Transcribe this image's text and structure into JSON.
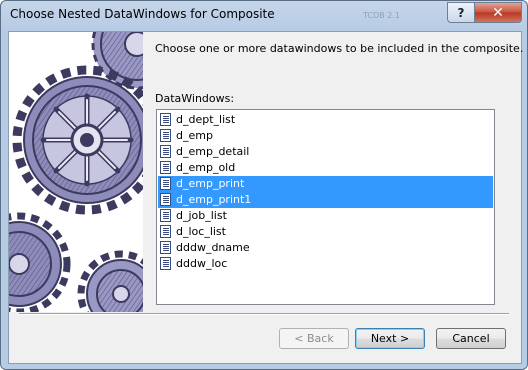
{
  "window": {
    "title": "Choose Nested DataWindows for Composite",
    "title_ghost_text": "TCDB 2.1",
    "help_label": "?",
    "close_label": "✕"
  },
  "intro_text": "Choose one or more datawindows to be included in the composite.",
  "list_label": "DataWindows:",
  "datawindows": [
    {
      "name": "d_dept_list",
      "selected": false
    },
    {
      "name": "d_emp",
      "selected": false
    },
    {
      "name": "d_emp_detail",
      "selected": false
    },
    {
      "name": "d_emp_old",
      "selected": false
    },
    {
      "name": "d_emp_print",
      "selected": true
    },
    {
      "name": "d_emp_print1",
      "selected": true
    },
    {
      "name": "d_job_list",
      "selected": false
    },
    {
      "name": "d_loc_list",
      "selected": false
    },
    {
      "name": "dddw_dname",
      "selected": false
    },
    {
      "name": "dddw_loc",
      "selected": false
    }
  ],
  "buttons": {
    "back": "< Back",
    "next": "Next >",
    "cancel": "Cancel"
  },
  "colors": {
    "selection": "#3399ff",
    "gear_ink": "#3c3a5e",
    "gear_fill": "#8e8cba"
  },
  "icons": {
    "list_item_icon": "datawindow-document-icon",
    "banner_art": "gears-illustration"
  }
}
